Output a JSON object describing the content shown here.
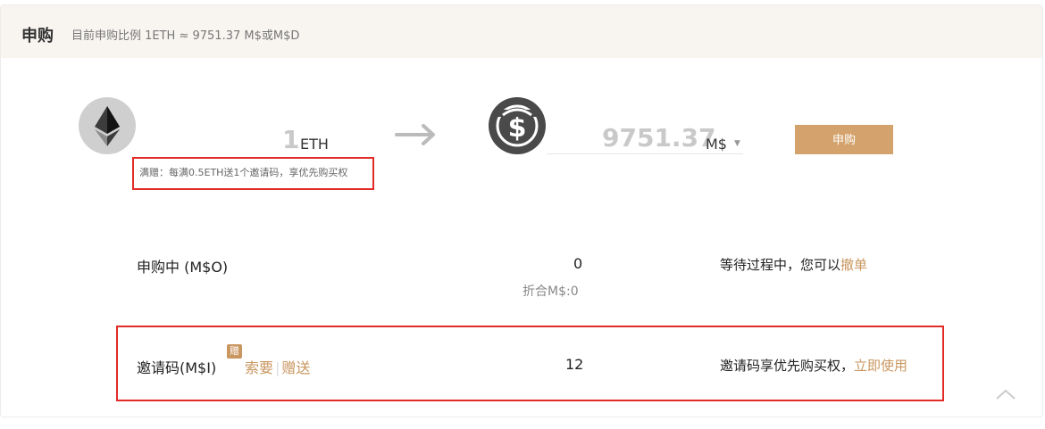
{
  "header": {
    "title": "申购",
    "subtitle": "目前申购比例 1ETH ≈ 9751.37 M$或M$D"
  },
  "exchange": {
    "from_amount": "1",
    "from_unit": "ETH",
    "to_amount": "9751.37",
    "to_unit": "M$",
    "submit_label": "申购",
    "bonus_text": "满赠：每满0.5ETH送1个邀请码，享优先购买权"
  },
  "pending": {
    "label": "申购中 (M$O)",
    "value": "0",
    "equivalent": "折合M$:0",
    "note": "等待过程中，您可以",
    "action_label": "撤单"
  },
  "invite": {
    "label": "邀请码(M$I)",
    "badge": "赠",
    "request_label": "索要",
    "gift_label": "赠送",
    "value": "12",
    "note": "邀请码享优先购买权，",
    "action_label": "立即使用"
  },
  "colors": {
    "accent": "#d4a36d",
    "link": "#c9965f",
    "highlight": "#e02b27",
    "header_bg": "#f8f5f1"
  },
  "icons": {
    "from_currency": "ethereum-icon",
    "to_currency": "msd-coin-icon",
    "arrow": "arrow-right-icon",
    "dropdown": "caret-down-icon",
    "scroll_top": "chevron-up-icon"
  }
}
